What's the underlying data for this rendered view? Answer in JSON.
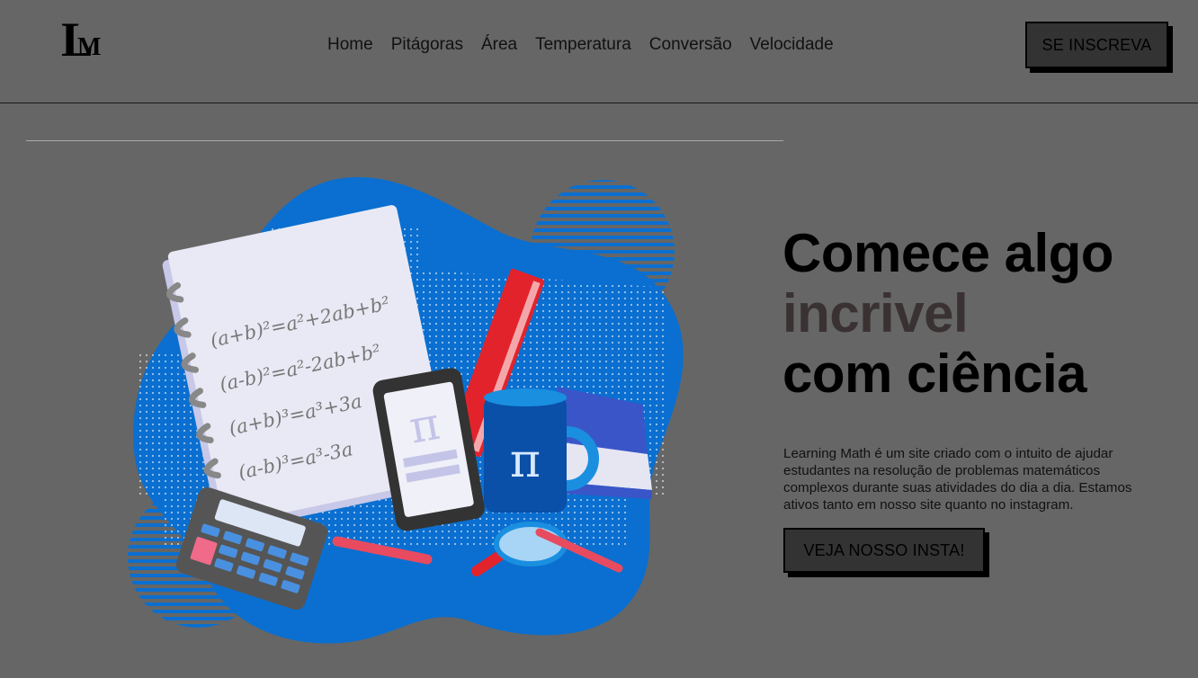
{
  "header": {
    "logo": {
      "letter_big": "L",
      "letter_small": "M"
    },
    "nav": [
      {
        "label": "Home"
      },
      {
        "label": "Pitágoras"
      },
      {
        "label": "Área"
      },
      {
        "label": "Temperatura"
      },
      {
        "label": "Conversão"
      },
      {
        "label": "Velocidade"
      }
    ],
    "subscribe_label": "SE INSCREVA"
  },
  "hero": {
    "headline_line1": "Comece algo",
    "headline_line2": "incrivel",
    "headline_line3": "com ciência",
    "description": "Learning Math é um site criado com o intuito de ajudar estudantes na resolução de problemas matemáticos complexos durante suas atividades do dia a dia. Estamos ativos tanto em nosso site quanto no instagram.",
    "cta_label": "VEJA NOSSO INSTA!"
  },
  "illustration": {
    "formulas": [
      "(a+b)²=a²+2ab+b²",
      "(a-b)²=a²-2ab+b²",
      "(a+b)³=a³+3a",
      "(a-b)³=a³-3a"
    ],
    "pi_symbol": "π"
  },
  "colors": {
    "background": "#666666",
    "button_bg": "#333333",
    "accent_text": "#3a3232",
    "illustration_blue": "#0a6fd0"
  }
}
